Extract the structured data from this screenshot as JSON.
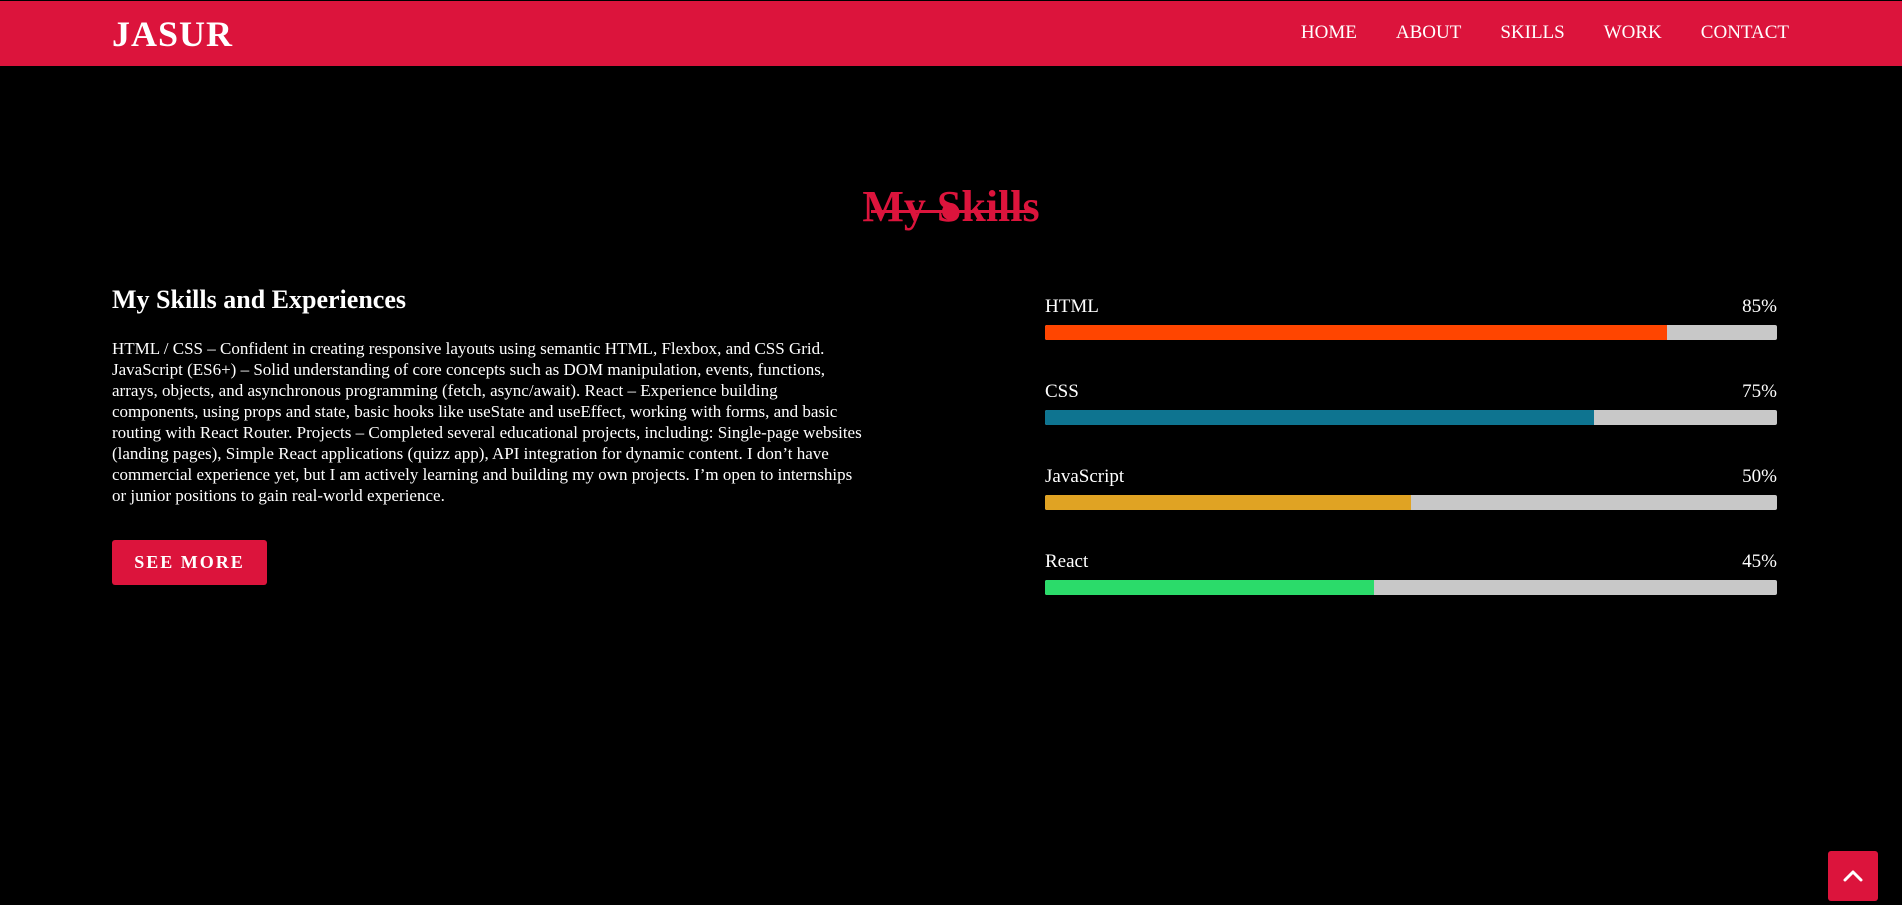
{
  "navbar": {
    "logo": "JASUR",
    "links": [
      "HOME",
      "ABOUT",
      "SKILLS",
      "WORK",
      "CONTACT"
    ]
  },
  "section": {
    "title": "My Skills"
  },
  "about": {
    "heading": "My Skills and Experiences",
    "body": "HTML / CSS – Confident in creating responsive layouts using semantic HTML, Flexbox, and CSS Grid. JavaScript (ES6+) – Solid understanding of core concepts such as DOM manipulation, events, functions, arrays, objects, and asynchronous programming (fetch, async/await). React – Experience building components, using props and state, basic hooks like useState and useEffect, working with forms, and basic routing with React Router. Projects – Completed several educational projects, including: Single-page websites (landing pages), Simple React applications (quizz app), API integration for dynamic content. I don’t have commercial experience yet, but I am actively learning and building my own projects. I’m open to internships or junior positions to gain real-world experience.",
    "button_label": "SEE MORE"
  },
  "skills": [
    {
      "name": "HTML",
      "percent_label": "85%",
      "level": 85,
      "color": "#ff4500"
    },
    {
      "name": "CSS",
      "percent_label": "75%",
      "level": 75,
      "color": "#0e7490"
    },
    {
      "name": "JavaScript",
      "percent_label": "50%",
      "level": 50,
      "color": "#e0a323"
    },
    {
      "name": "React",
      "percent_label": "45%",
      "level": 45,
      "color": "#2bdb6a"
    }
  ],
  "scroll_top": {
    "icon": "chevron-up-icon"
  },
  "colors": {
    "accent": "#dc143c",
    "background": "#000000",
    "track": "#c8c8c8"
  }
}
